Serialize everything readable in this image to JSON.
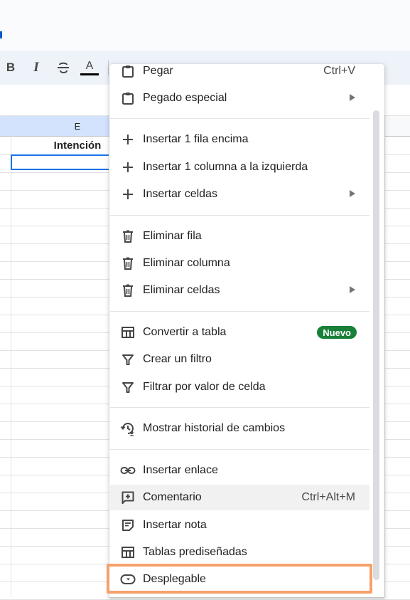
{
  "toolbar": {
    "bold_label": "B",
    "italic_label": "I",
    "text_color_label": "A"
  },
  "sheet": {
    "column_letter": "E",
    "header_cell_value": "Intención"
  },
  "context_menu": {
    "items": [
      {
        "label": "Pegar",
        "shortcut": "Ctrl+V",
        "icon": "clipboard-icon"
      },
      {
        "label": "Pegado especial",
        "icon": "clipboard-icon",
        "submenu": true
      },
      {
        "label": "Insertar 1 fila encima",
        "icon": "plus-icon"
      },
      {
        "label": "Insertar 1 columna a la izquierda",
        "icon": "plus-icon"
      },
      {
        "label": "Insertar celdas",
        "icon": "plus-icon",
        "submenu": true
      },
      {
        "label": "Eliminar fila",
        "icon": "trash-icon"
      },
      {
        "label": "Eliminar columna",
        "icon": "trash-icon"
      },
      {
        "label": "Eliminar celdas",
        "icon": "trash-icon",
        "submenu": true
      },
      {
        "label": "Convertir a tabla",
        "icon": "table-icon",
        "badge": "Nuevo"
      },
      {
        "label": "Crear un filtro",
        "icon": "filter-icon"
      },
      {
        "label": "Filtrar por valor de celda",
        "icon": "filter-icon"
      },
      {
        "label": "Mostrar historial de cambios",
        "icon": "history-icon"
      },
      {
        "label": "Insertar enlace",
        "icon": "link-icon"
      },
      {
        "label": "Comentario",
        "shortcut": "Ctrl+Alt+M",
        "icon": "add-comment-icon"
      },
      {
        "label": "Insertar nota",
        "icon": "note-icon"
      },
      {
        "label": "Tablas prediseñadas",
        "icon": "table-icon"
      },
      {
        "label": "Desplegable",
        "icon": "dropdown-chip-icon"
      }
    ]
  },
  "colors": {
    "highlight_outline": "#f6a06b",
    "badge_green": "#188038",
    "selection_blue": "#1a73e8"
  }
}
